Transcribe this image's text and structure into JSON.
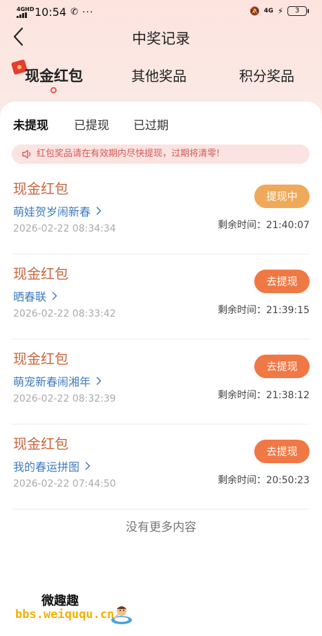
{
  "status_bar": {
    "network": "4GHD",
    "time": "10:54",
    "battery": "3",
    "net_right": "4G"
  },
  "nav": {
    "title": "中奖记录"
  },
  "tabs": [
    {
      "label": "现金红包",
      "active": true
    },
    {
      "label": "其他奖品",
      "active": false
    },
    {
      "label": "积分奖品",
      "active": false
    }
  ],
  "subtabs": [
    {
      "label": "未提现",
      "active": true
    },
    {
      "label": "已提现",
      "active": false
    },
    {
      "label": "已过期",
      "active": false
    }
  ],
  "notice": "红包奖品请在有效期内尽快提现，过期将清零!",
  "items": [
    {
      "title": "现金红包",
      "event": "萌娃贺岁闹新春",
      "date": "2026-02-22 08:34:34",
      "button": "提现中",
      "remain": "剩余时间：21:40:07"
    },
    {
      "title": "现金红包",
      "event": "晒春联",
      "date": "2026-02-22 08:33:42",
      "button": "去提现",
      "remain": "剩余时间：21:39:15"
    },
    {
      "title": "现金红包",
      "event": "萌宠新春闹湘年",
      "date": "2026-02-22 08:32:39",
      "button": "去提现",
      "remain": "剩余时间：21:38:12"
    },
    {
      "title": "现金红包",
      "event": "我的春运拼图",
      "date": "2026-02-22 07:44:50",
      "button": "去提现",
      "remain": "剩余时间：20:50:23"
    }
  ],
  "footer": "没有更多内容",
  "watermark": {
    "title": "微趣趣",
    "url": "bbs.weiququ.cn"
  },
  "colors": {
    "accent_orange": "#f07845",
    "processing_orange": "#f0a95a",
    "title_brown": "#c8663e",
    "link_blue": "#3f7ac0",
    "notice_bg": "#fbe3e1"
  }
}
